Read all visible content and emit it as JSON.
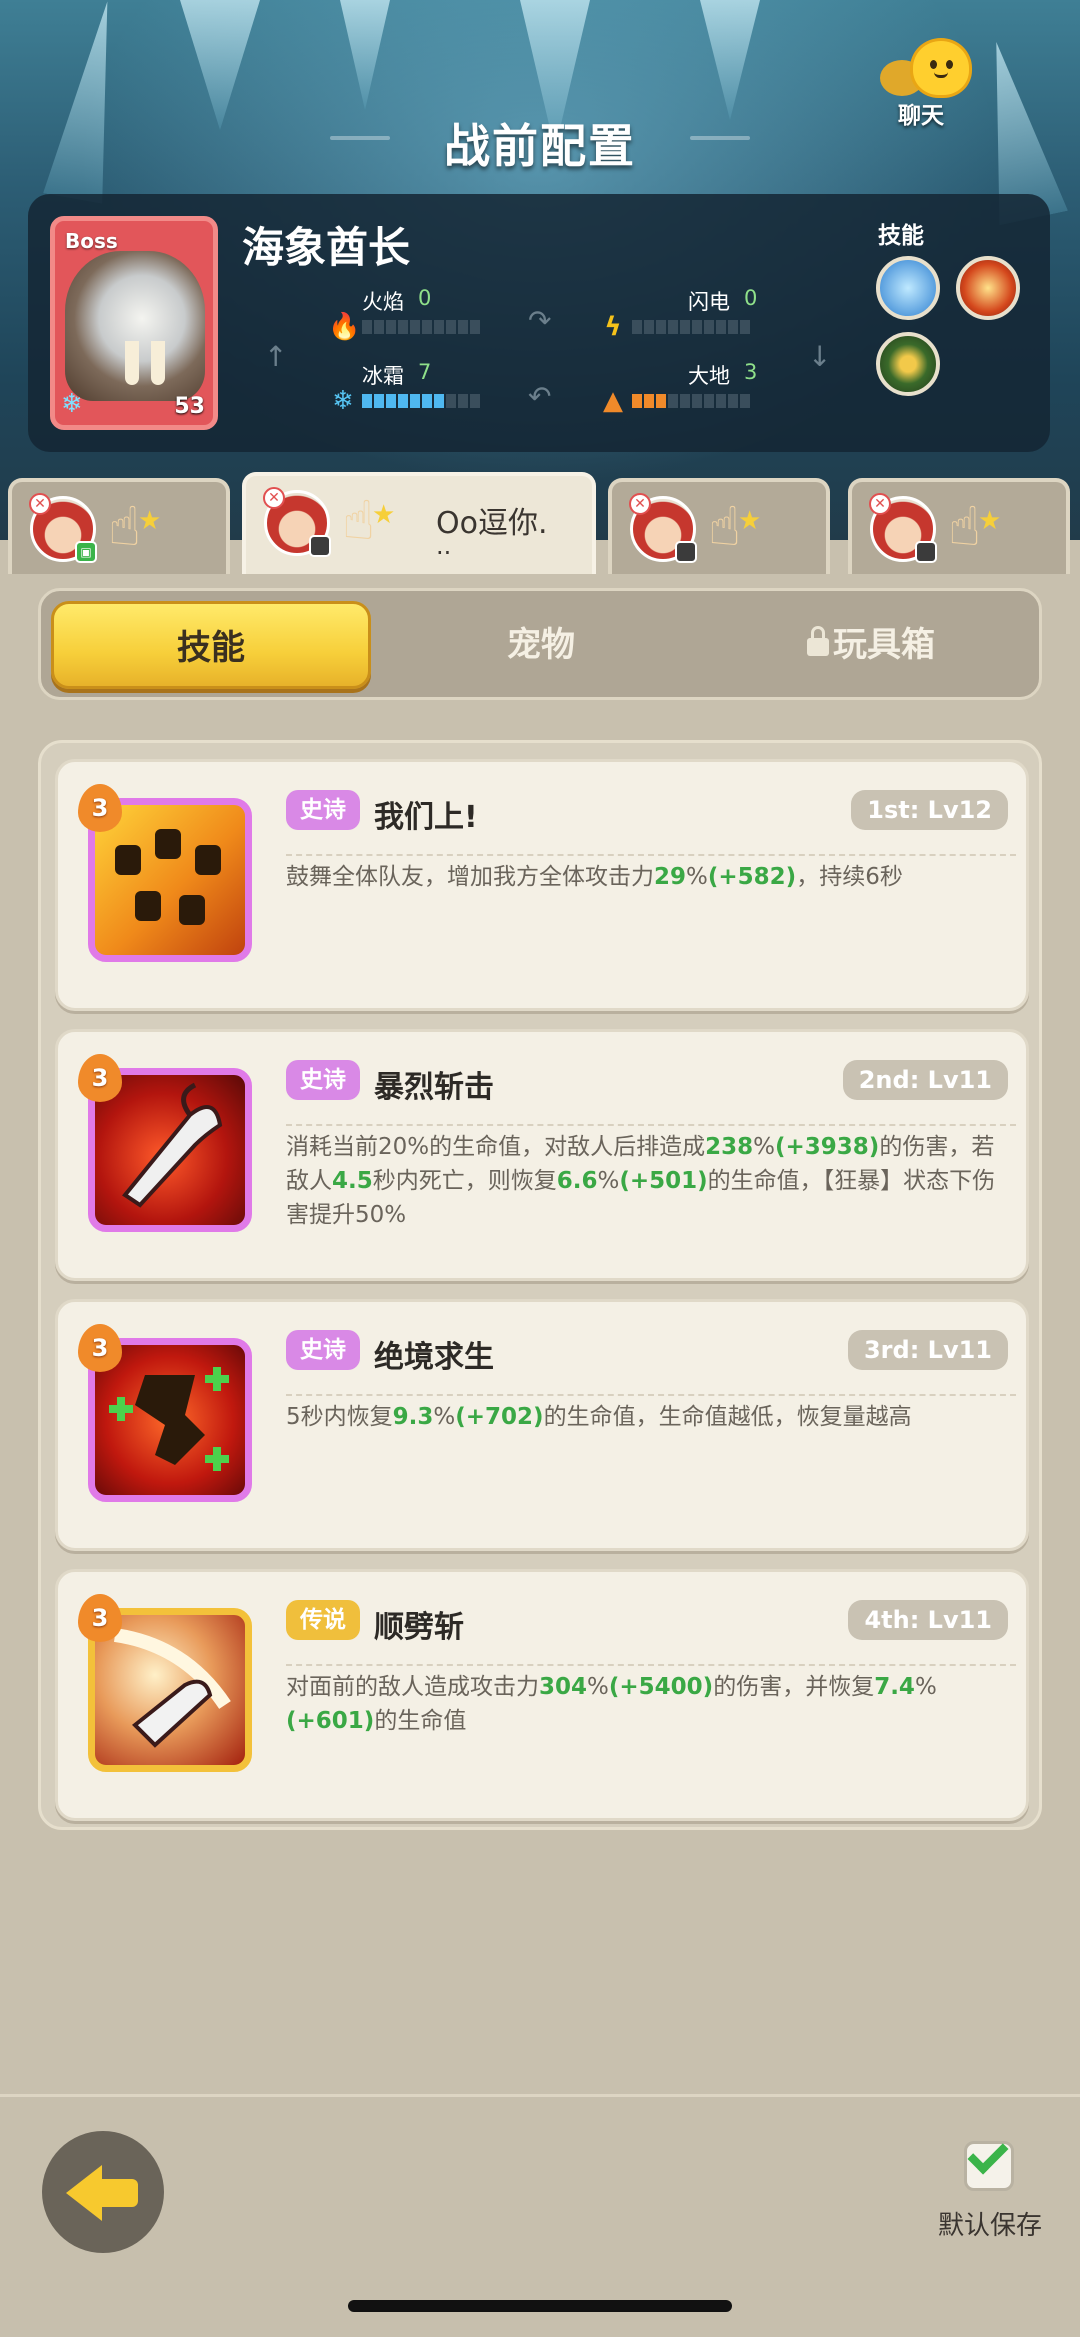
{
  "header": {
    "title": "战前配置",
    "chat_label": "聊天"
  },
  "boss": {
    "tag": "Boss",
    "name": "海象酋长",
    "level": "53",
    "skills_label": "技能",
    "elements": {
      "fire": {
        "label": "火焰",
        "value": "0",
        "level": 0
      },
      "lightning": {
        "label": "闪电",
        "value": "0",
        "level": 0
      },
      "frost": {
        "label": "冰霜",
        "value": "7",
        "level": 7
      },
      "earth": {
        "label": "大地",
        "value": "3",
        "level": 3
      }
    }
  },
  "team_tabs": [
    {
      "name": "",
      "active": false
    },
    {
      "name": "Oo逗你.",
      "name_sub": "..",
      "active": true
    },
    {
      "name": "",
      "active": false
    },
    {
      "name": "",
      "active": false
    }
  ],
  "segments": {
    "skills": "技能",
    "pets": "宠物",
    "toybox": "玩具箱"
  },
  "skills": [
    {
      "rarity": "史诗",
      "name": "我们上!",
      "slot": "1st: Lv12",
      "badge": "3",
      "desc": [
        {
          "t": "鼓舞全体队友，增加我方全体攻击力"
        },
        {
          "t": "29",
          "hl": true
        },
        {
          "t": "%"
        },
        {
          "t": "(+582)",
          "hl": true
        },
        {
          "t": "，持续6秒"
        }
      ]
    },
    {
      "rarity": "史诗",
      "name": "暴烈斩击",
      "slot": "2nd: Lv11",
      "badge": "3",
      "desc": [
        {
          "t": "消耗当前20%的生命值，对敌人后排造成"
        },
        {
          "t": "238",
          "hl": true
        },
        {
          "t": "%"
        },
        {
          "t": "(+3938)",
          "hl": true
        },
        {
          "t": "的伤害，若敌人"
        },
        {
          "t": "4.5",
          "hl": true
        },
        {
          "t": "秒内死亡，则恢复"
        },
        {
          "t": "6.6",
          "hl": true
        },
        {
          "t": "%"
        },
        {
          "t": "(+501)",
          "hl": true
        },
        {
          "t": "的生命值，【狂暴】状态下伤害提升50%"
        }
      ]
    },
    {
      "rarity": "史诗",
      "name": "绝境求生",
      "slot": "3rd: Lv11",
      "badge": "3",
      "desc": [
        {
          "t": "5秒内恢复"
        },
        {
          "t": "9.3",
          "hl": true
        },
        {
          "t": "%"
        },
        {
          "t": "(+702)",
          "hl": true
        },
        {
          "t": "的生命值，生命值越低，恢复量越高"
        }
      ]
    },
    {
      "rarity": "传说",
      "name": "顺劈斩",
      "slot": "4th: Lv11",
      "badge": "3",
      "desc": [
        {
          "t": "对面前的敌人造成攻击力"
        },
        {
          "t": "304",
          "hl": true
        },
        {
          "t": "%"
        },
        {
          "t": "(+5400)",
          "hl": true
        },
        {
          "t": "的伤害，并恢复"
        },
        {
          "t": "7.4",
          "hl": true
        },
        {
          "t": "%"
        },
        {
          "t": "(+601)",
          "hl": true
        },
        {
          "t": "的生命值"
        }
      ]
    }
  ],
  "footer": {
    "save_label": "默认保存"
  }
}
